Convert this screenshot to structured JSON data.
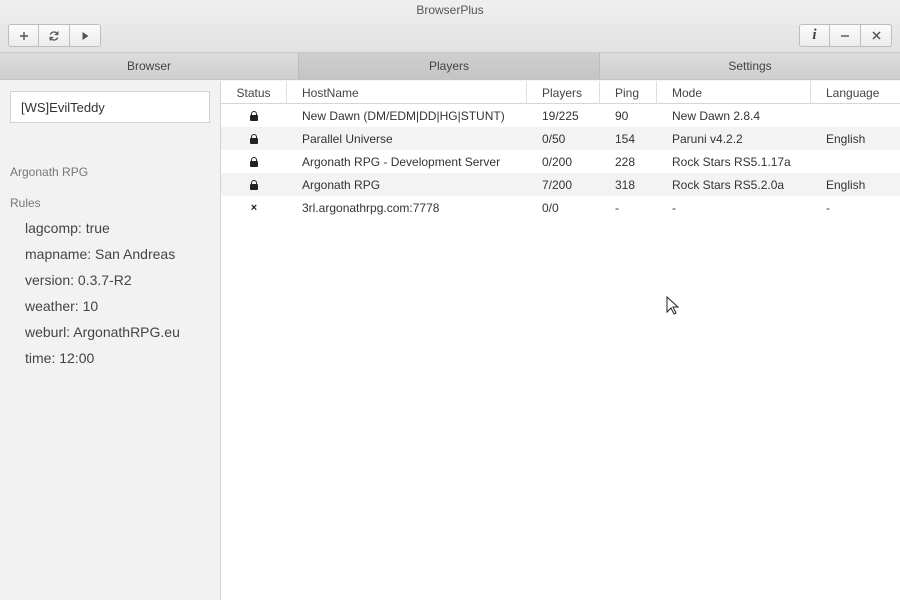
{
  "window": {
    "title": "BrowserPlus"
  },
  "toolbar": {
    "left_icons": [
      "plus-icon",
      "refresh-icon",
      "play-icon"
    ],
    "right_icons": [
      "info-icon",
      "minimize-icon",
      "close-icon"
    ]
  },
  "tabs": [
    {
      "label": "Browser"
    },
    {
      "label": "Players"
    },
    {
      "label": "Settings"
    }
  ],
  "sidebar": {
    "player_name": "[WS]EvilTeddy",
    "server_name": "Argonath RPG",
    "rules_label": "Rules",
    "rules": [
      "lagcomp: true",
      "mapname: San Andreas",
      "version: 0.3.7-R2",
      "weather: 10",
      "weburl: ArgonathRPG.eu",
      "time: 12:00"
    ]
  },
  "table": {
    "headers": [
      "Status",
      "HostName",
      "Players",
      "Ping",
      "Mode",
      "Language"
    ],
    "rows": [
      {
        "status": "locked",
        "host": "New Dawn (DM/EDM|DD|HG|STUNT)",
        "players": "19/225",
        "ping": "90",
        "mode": "New Dawn 2.8.4",
        "language": ""
      },
      {
        "status": "locked",
        "host": "Parallel Universe",
        "players": "0/50",
        "ping": "154",
        "mode": "Paruni v4.2.2",
        "language": "English"
      },
      {
        "status": "locked",
        "host": "Argonath RPG - Development Server",
        "players": "0/200",
        "ping": "228",
        "mode": "Rock Stars RS5.1.17a",
        "language": ""
      },
      {
        "status": "locked",
        "host": "Argonath RPG",
        "players": "7/200",
        "ping": "318",
        "mode": "Rock Stars RS5.2.0a",
        "language": "English"
      },
      {
        "status": "offline",
        "host": "3rl.argonathrpg.com:7778",
        "players": "0/0",
        "ping": "-",
        "mode": "-",
        "language": "-"
      }
    ]
  },
  "colors": {
    "titlebar": "#e6e6e6",
    "tab_active": "#c8c8c8",
    "row_alt": "#f3f3f3"
  }
}
